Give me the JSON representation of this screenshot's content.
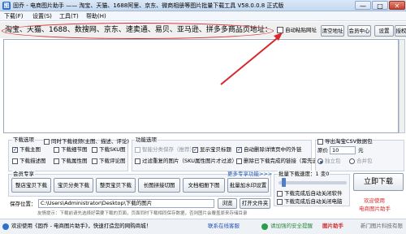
{
  "window": {
    "icon_glyph": "图",
    "title": "固乔 - 电商图片助手 —— 淘宝、天猫、1688阿里、京东、微商相册等图片批量下载工具 V58.0.0.8 正式版",
    "min_label": "—",
    "max_label": "□",
    "close_label": "✕"
  },
  "menu": [
    "下载(F)",
    "设置(S)",
    "工具(T)",
    "帮助(H)"
  ],
  "url_row": {
    "sites": "淘宝、天猫、1688、数搜网、京东、速卖通、易贝、亚马逊、拼多多商品页地址：",
    "auto_paste_label": "自动粘贴网址",
    "buttons": [
      "清空地址",
      "会员中心",
      "设置",
      "授权"
    ]
  },
  "download_options": {
    "title": "下载选项",
    "items": [
      {
        "label": "同时下载视频(主图、描述、评论)",
        "checked": false
      },
      {
        "label": "下载主图",
        "checked": true
      },
      {
        "label": "下载细节图",
        "checked": false
      },
      {
        "label": "下载SKU图",
        "checked": false
      },
      {
        "label": "下载描述图",
        "checked": false
      },
      {
        "label": "下载属性图",
        "checked": false
      },
      {
        "label": "下载评论图",
        "checked": false
      }
    ]
  },
  "function_options": {
    "title": "功能选项",
    "items": [
      {
        "label": "智能分类保存（推荐）",
        "checked": false,
        "disabled": true
      },
      {
        "label": "显示宝贝标题",
        "checked": true,
        "disabled": false
      },
      {
        "label": "自动删除详情页中的外链",
        "checked": true,
        "disabled": false
      },
      {
        "label": "过滤重复的图片（SKU属性图片才过滤）",
        "checked": false,
        "disabled": false
      },
      {
        "label": "删除已下载完成的链接（需先选择）",
        "checked": false,
        "disabled": false
      }
    ]
  },
  "right_options": {
    "csv_label": "导出淘宝CSV数据包",
    "price_label": "原价",
    "price_value": "10",
    "price_unit": "元",
    "radio_1": "独立包",
    "radio_2": "合并包"
  },
  "member": {
    "title": "会员专享",
    "more_label": "更多专享功能>>>",
    "buttons_row1": [
      "整店宝贝下载",
      "宝贝分类下载",
      "整页宝贝下载",
      "长图拼接切图",
      "文档相册下图",
      "批量加水印设置"
    ],
    "buttons_row2": [
      "合并下载",
      "收货地址",
      "评论管理",
      "采集助手",
      "一键生图",
      "转换格式"
    ]
  },
  "speed": {
    "title": "批量下载速度：1 变0",
    "opt1": "下载完成后自动关闭软件",
    "opt2": "下载完成后自动关闭电脑"
  },
  "save": {
    "label": "保存位置：",
    "path": "C:\\Users\\Administrator\\Desktop\\下载的图片",
    "browse_label": "浏览",
    "open_label": "打开文件夹",
    "hint": "友情提示：下载前请先选择好需要下载的页面，页面同时下载相同保存数据，否则图片会覆盖原来存储目录"
  },
  "start_button": "立即下载",
  "promo": [
    "欢迎使用",
    "电商图片助手"
  ],
  "status": {
    "welcome": "欢迎使用《固乔 - 电商图片助手》，快速打造您的网购商城！",
    "contact": "联系在线客服",
    "notice": "请加强的安全提醒",
    "brand": "图片助手",
    "version": "新门图片科技有限"
  }
}
